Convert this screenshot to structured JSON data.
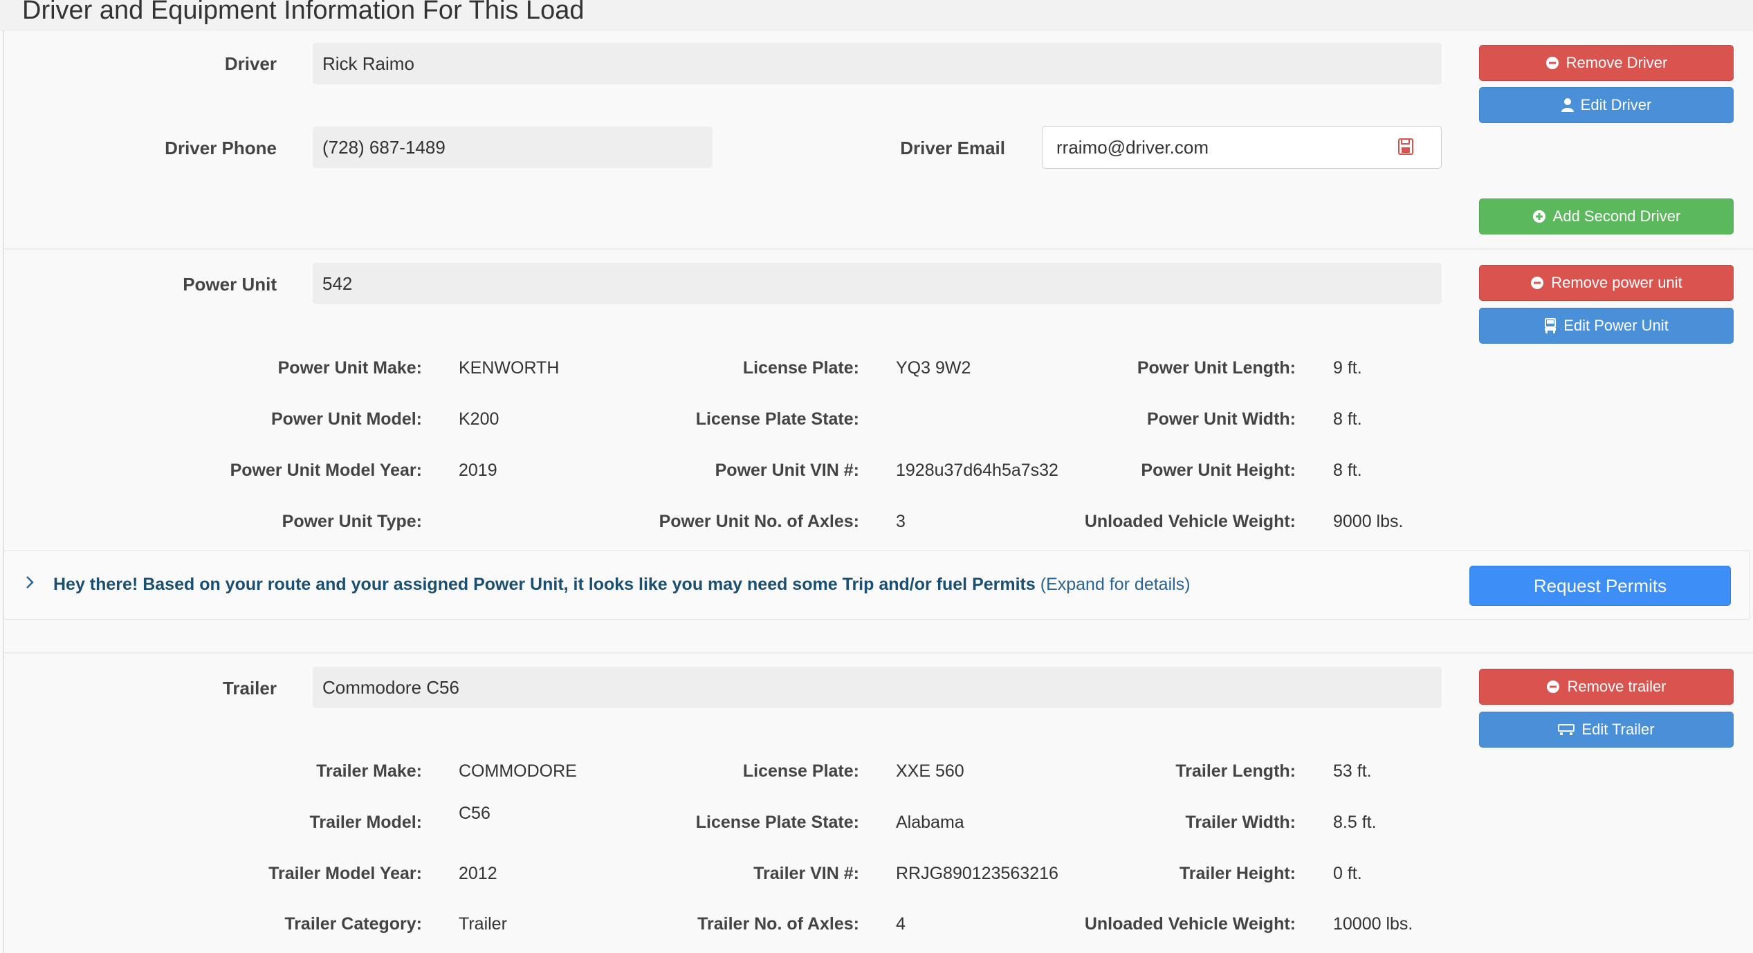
{
  "header": {
    "title": "Driver and Equipment Information For This Load"
  },
  "driver": {
    "label": "Driver",
    "name": "Rick Raimo",
    "phone_label": "Driver Phone",
    "phone": "(728) 687-1489",
    "email_label": "Driver Email",
    "email": "rraimo@driver.com",
    "email_icon": "save-icon",
    "remove_label": "Remove Driver",
    "edit_label": "Edit Driver",
    "add_second_label": "Add Second Driver"
  },
  "power_unit": {
    "label": "Power Unit",
    "value": "542",
    "remove_label": "Remove power unit",
    "edit_label": "Edit Power Unit",
    "details": {
      "make_label": "Power Unit Make:",
      "make": "KENWORTH",
      "model_label": "Power Unit Model:",
      "model": "K200",
      "year_label": "Power Unit Model Year:",
      "year": "2019",
      "type_label": "Power Unit Type:",
      "type": "",
      "plate_label": "License Plate:",
      "plate": "YQ3 9W2",
      "plate_state_label": "License Plate State:",
      "plate_state": "",
      "vin_label": "Power Unit VIN #:",
      "vin": "1928u37d64h5a7s32",
      "axles_label": "Power Unit No. of Axles:",
      "axles": "3",
      "length_label": "Power Unit Length:",
      "length": "9 ft.",
      "width_label": "Power Unit Width:",
      "width": "8 ft.",
      "height_label": "Power Unit Height:",
      "height": "8 ft.",
      "weight_label": "Unloaded Vehicle Weight:",
      "weight": "9000 lbs."
    }
  },
  "permits": {
    "message": "Hey there! Based on your route and your assigned Power Unit, it looks like you may need some Trip and/or fuel Permits",
    "expand": "(Expand for details)",
    "button": "Request Permits"
  },
  "trailer": {
    "label": "Trailer",
    "value": "Commodore C56",
    "remove_label": "Remove trailer",
    "edit_label": "Edit Trailer",
    "details": {
      "make_label": "Trailer Make:",
      "make": "COMMODORE",
      "model_label": "Trailer Model:",
      "model": "C56",
      "year_label": "Trailer Model Year:",
      "year": "2012",
      "category_label": "Trailer Category:",
      "category": "Trailer",
      "plate_label": "License Plate:",
      "plate": "XXE 560",
      "plate_state_label": "License Plate State:",
      "plate_state": "Alabama",
      "vin_label": "Trailer VIN #:",
      "vin": "RRJG890123563216",
      "axles_label": "Trailer No. of Axles:",
      "axles": "4",
      "length_label": "Trailer Length:",
      "length": "53 ft.",
      "width_label": "Trailer Width:",
      "width": "8.5 ft.",
      "height_label": "Trailer Height:",
      "height": "0 ft.",
      "weight_label": "Unloaded Vehicle Weight:",
      "weight": "10000 lbs."
    }
  },
  "colors": {
    "danger": "#d9534f",
    "info": "#4a90d9",
    "success": "#5cb85c",
    "primary": "#3e8ef7",
    "notice_text": "#1b4f72"
  }
}
